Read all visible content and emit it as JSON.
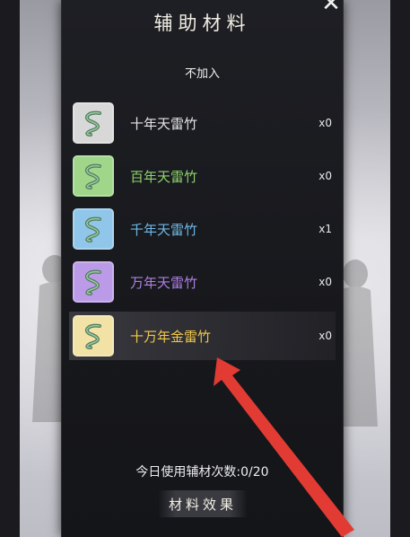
{
  "dialog": {
    "title": "辅助材料",
    "no_add_label": "不加入",
    "items": [
      {
        "name": "十年天雷竹",
        "count": "x0",
        "name_color": "#e6e6e6",
        "frame_color": "#d8d8d8",
        "icon": "thunder-bamboo-icon"
      },
      {
        "name": "百年天雷竹",
        "count": "x0",
        "name_color": "#8fd36b",
        "frame_color": "#9fd68a",
        "icon": "thunder-bamboo-icon"
      },
      {
        "name": "千年天雷竹",
        "count": "x1",
        "name_color": "#6fb8e8",
        "frame_color": "#8fc6e9",
        "icon": "thunder-bamboo-icon"
      },
      {
        "name": "万年天雷竹",
        "count": "x0",
        "name_color": "#b07fe6",
        "frame_color": "#bb9ae8",
        "icon": "thunder-bamboo-icon"
      },
      {
        "name": "十万年金雷竹",
        "count": "x0",
        "name_color": "#f2c94c",
        "frame_color": "#f2e2a6",
        "icon": "golden-thunder-bamboo-icon"
      }
    ],
    "usage_text": "今日使用辅材次数:0/20",
    "effect_button_label": "材料效果"
  },
  "colors": {
    "annotation_arrow": "#e23b33"
  }
}
